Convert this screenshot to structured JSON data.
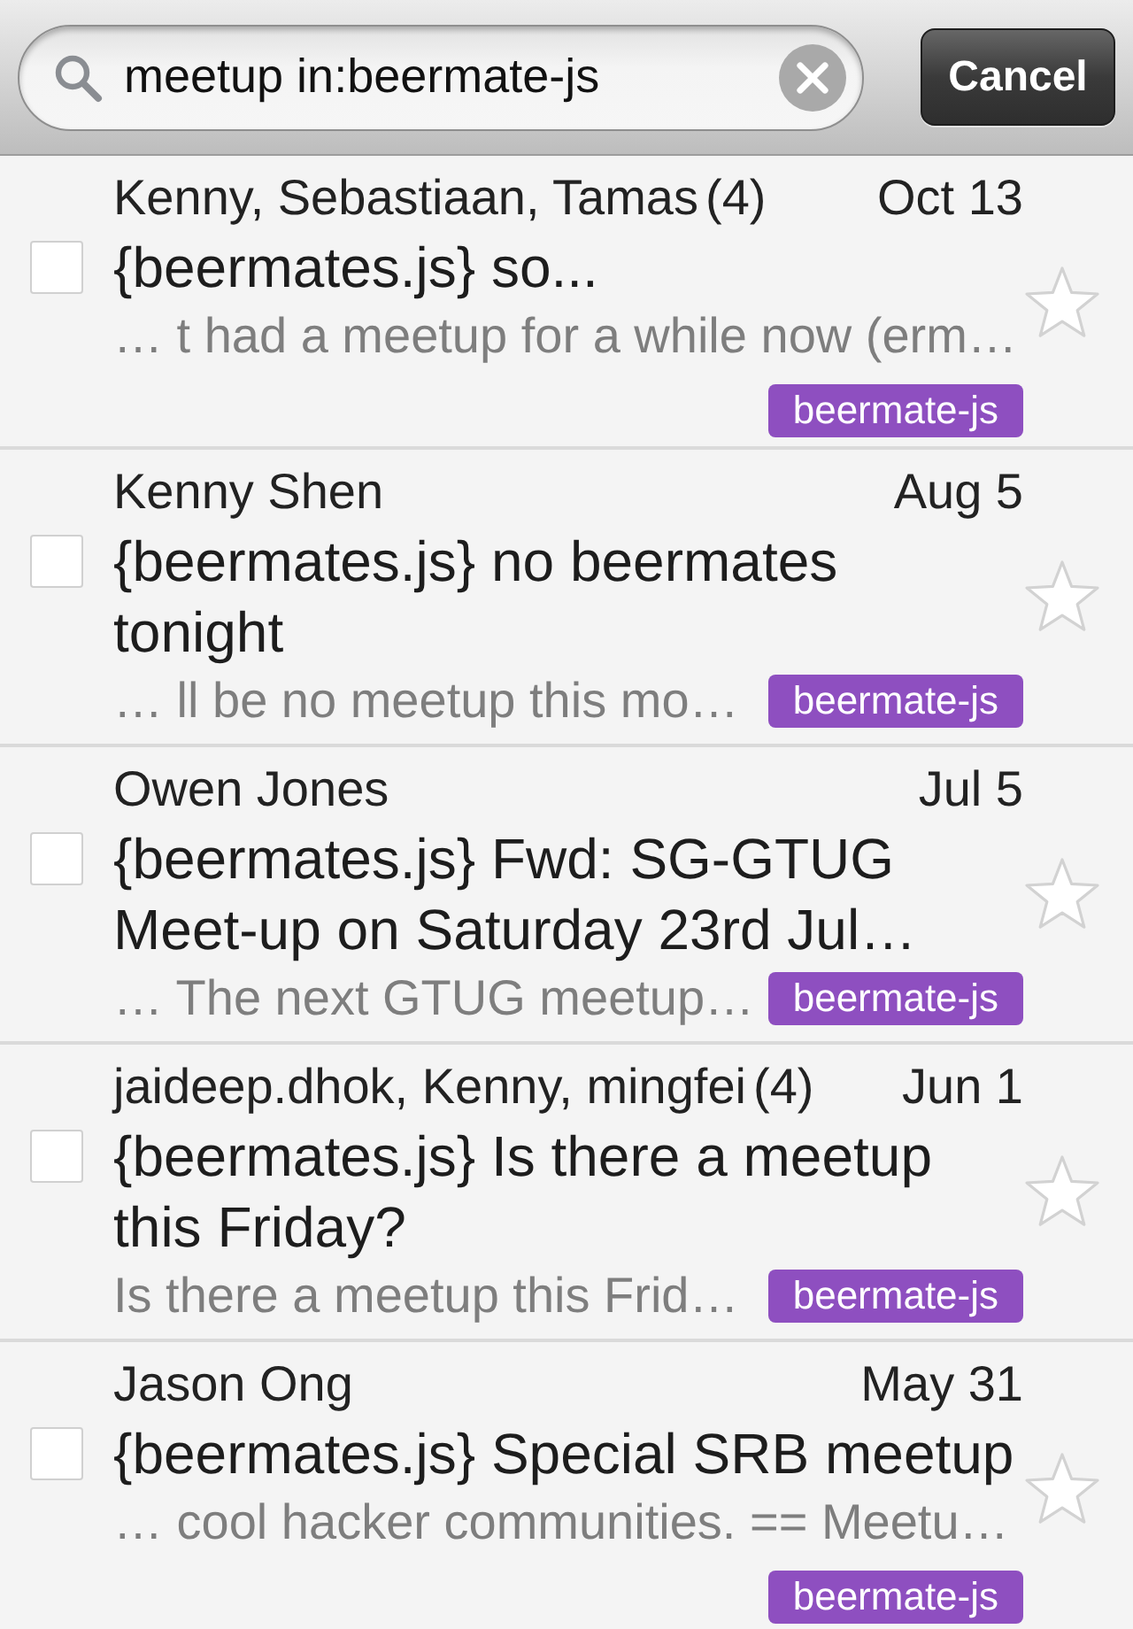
{
  "search": {
    "query": "meetup in:beermate-js"
  },
  "cancel_button": "Cancel",
  "threads": [
    {
      "sender": "Kenny, Sebastiaan, Tamas",
      "count": "(4)",
      "date": "Oct 13",
      "subject": "{beermates.js} so...",
      "snippet": "… t had a meetup for a while now (erm…",
      "label": "beermate-js",
      "checked": false,
      "starred": false
    },
    {
      "sender": "Kenny Shen",
      "date": "Aug 5",
      "subject": "{beermates.js} no beermates tonight",
      "snippet": "… ll be no meetup this mo…",
      "label": "beermate-js",
      "checked": false,
      "starred": false
    },
    {
      "sender": "Owen Jones",
      "date": "Jul 5",
      "subject": "{beermates.js} Fwd: SG-GTUG Meet-up on Saturday 23rd Jul…",
      "snippet": "… The next GTUG meetup…",
      "label": "beermate-js",
      "checked": false,
      "starred": false
    },
    {
      "sender": "jaideep.dhok, Kenny, mingfei",
      "count": "(4)",
      "date": "Jun 1",
      "subject": "{beermates.js} Is there a meetup this Friday?",
      "snippet": "Is there a meetup this Frid…",
      "label": "beermate-js",
      "checked": false,
      "starred": false
    },
    {
      "sender": "Jason Ong",
      "date": "May 31",
      "subject": "{beermates.js} Special SRB meetup",
      "snippet": "… cool hacker communities. == Meetu…",
      "label": "beermate-js",
      "checked": false,
      "starred": false
    }
  ]
}
